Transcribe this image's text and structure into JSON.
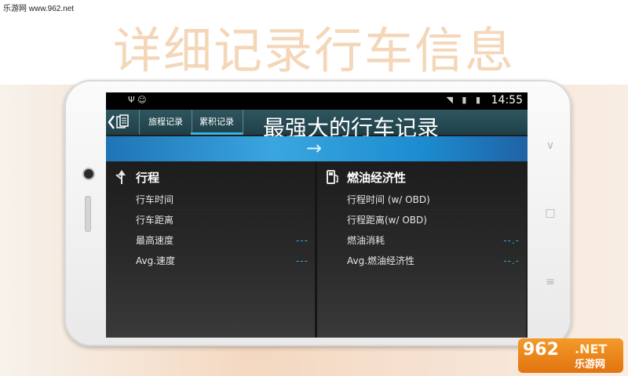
{
  "watermark": "乐游网 www.962.net",
  "headline": "详细记录行车信息",
  "status_bar": {
    "left_icons": "Ψ ☺",
    "right_icons": "◥ ▮ ▮",
    "time": "14:55"
  },
  "app_bar": {
    "back_icon": "back-icon",
    "tabs": [
      {
        "label": "旅程记录",
        "selected": false
      },
      {
        "label": "累积记录",
        "selected": true
      }
    ],
    "banner": "最强大的行车记录"
  },
  "arrow_icon": "→",
  "panels": {
    "left": {
      "icon": "route-icon",
      "title": "行程",
      "rows": [
        {
          "label": "行车时间",
          "value": ""
        },
        {
          "label": "行车距离",
          "value": ""
        },
        {
          "label": "最高速度",
          "value": "---"
        },
        {
          "label": "Avg.速度",
          "value": "---"
        }
      ]
    },
    "right": {
      "icon": "fuel-pump-icon",
      "title": "燃油经济性",
      "rows": [
        {
          "label": "行程时间 (w/ OBD)",
          "value": ""
        },
        {
          "label": "行程距离(w/ OBD)",
          "value": ""
        },
        {
          "label": "燃油消耗",
          "value": "--.-"
        },
        {
          "label": "Avg.燃油经济性",
          "value": "--.-"
        }
      ]
    }
  },
  "nav_keys": [
    "∨",
    "□",
    "≡"
  ],
  "logo": {
    "num": "962",
    "net": ".NET",
    "cn": "乐游网"
  },
  "colors": {
    "accent": "#33b5e5",
    "headline": "#f4d6b8",
    "logo": "#f08a1c"
  }
}
